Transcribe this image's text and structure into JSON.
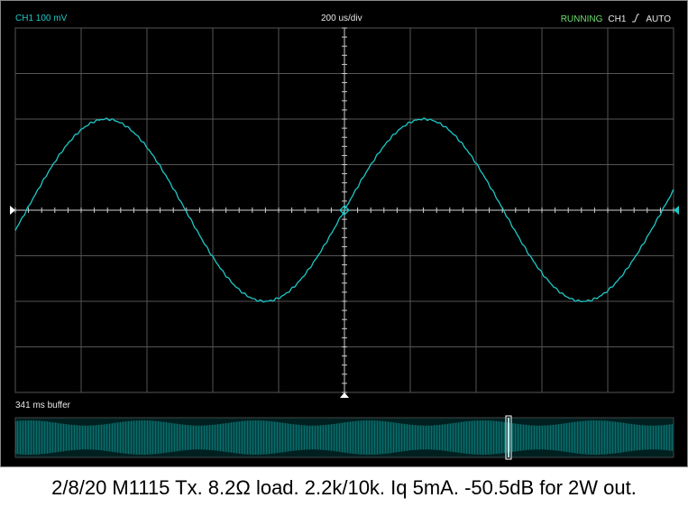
{
  "scope": {
    "channel_label": "CH1 100 mV",
    "timebase_label": "200 us/div",
    "run_state": "RUNNING",
    "trigger_channel": "CH1",
    "trigger_mode": "AUTO",
    "buffer_label": "341 ms buffer",
    "trace_color": "#1ec8c8",
    "grid_color": "#555555",
    "run_state_color": "#6fe06f"
  },
  "chart_data": {
    "type": "line",
    "title": "",
    "xlabel": "",
    "ylabel": "",
    "x_range_divisions": 10,
    "y_range_divisions": 8,
    "volts_per_division_mV": 100,
    "time_per_division_us": 200,
    "series": [
      {
        "amplitude_divisions": 2.0,
        "period_divisions": 4.83,
        "phase": "rising zero-crossing at center of screen",
        "waveform": "sine"
      }
    ]
  },
  "caption": {
    "text": "2/8/20 M1115 Tx. 8.2Ω load. 2.2k/10k. Iq 5mA. -50.5dB for 2W out."
  }
}
